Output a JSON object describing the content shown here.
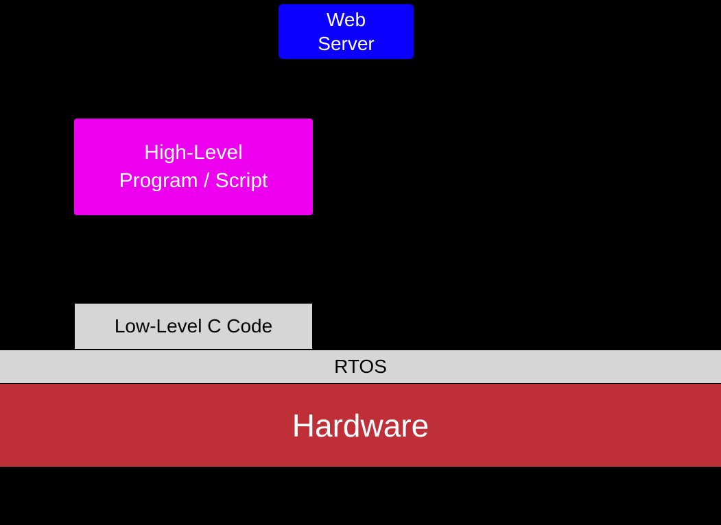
{
  "diagram": {
    "web_server": {
      "line1": "Web",
      "line2": "Server"
    },
    "high_level": {
      "line1": "High-Level",
      "line2": "Program / Script"
    },
    "low_level_c": "Low-Level C Code",
    "rtos": "RTOS",
    "hardware": "Hardware"
  },
  "colors": {
    "background": "#000000",
    "web_server_bg": "#0b00fd",
    "high_level_bg": "#ec00ed",
    "low_level_bg": "#d6d6d6",
    "rtos_bg": "#d6d6d6",
    "hardware_bg": "#bf2f38",
    "text_white": "#ffffff",
    "text_black": "#000000"
  }
}
